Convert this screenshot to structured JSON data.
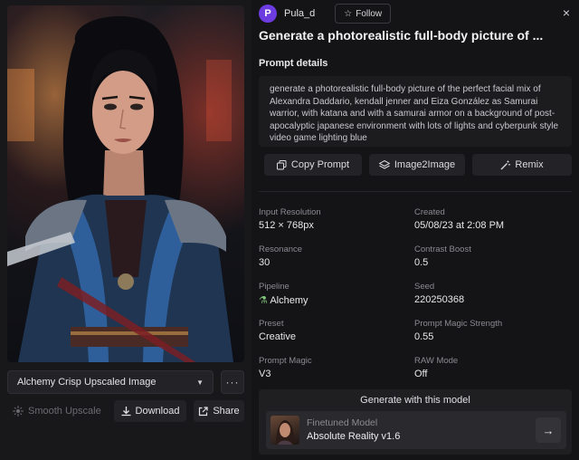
{
  "preset_select": {
    "value": "Alchemy Crisp Upscaled Image"
  },
  "left_actions": {
    "more": "···",
    "smooth_upscale": "Smooth Upscale",
    "download": "Download",
    "share": "Share"
  },
  "user": {
    "avatar_letter": "P",
    "name": "Pula_d",
    "follow_label": "Follow"
  },
  "close_icon": "×",
  "title": "Generate a photorealistic full-body picture of ...",
  "prompt": {
    "section_label": "Prompt details",
    "text": "generate a photorealistic full-body picture of the perfect facial mix of Alexandra Daddario, kendall jenner and Eiza González as Samurai warrior, with katana and with a samurai armor on a background of post-apocalyptic japanese environment with lots of lights and cyberpunk style video game lighting blue",
    "copy_label": "Copy Prompt",
    "image2image_label": "Image2Image",
    "remix_label": "Remix"
  },
  "details": [
    {
      "label": "Input Resolution",
      "value": "512 × 768px"
    },
    {
      "label": "Created",
      "value": "05/08/23 at 2:08 PM"
    },
    {
      "label": "Resonance",
      "value": "30"
    },
    {
      "label": "Contrast Boost",
      "value": "0.5"
    },
    {
      "label": "Pipeline",
      "value": "Alchemy"
    },
    {
      "label": "Seed",
      "value": "220250368"
    },
    {
      "label": "Preset",
      "value": "Creative"
    },
    {
      "label": "Prompt Magic Strength",
      "value": "0.55"
    },
    {
      "label": "Prompt Magic",
      "value": "V3"
    },
    {
      "label": "RAW Mode",
      "value": "Off"
    }
  ],
  "generate": {
    "title": "Generate with this model",
    "model_type": "Finetuned Model",
    "model_name": "Absolute Reality v1.6"
  },
  "colors": {
    "background": "#141416",
    "panel": "#1c1c1f",
    "avatar": "#6c3ce0",
    "accent_blue": "#2f5f9a"
  }
}
